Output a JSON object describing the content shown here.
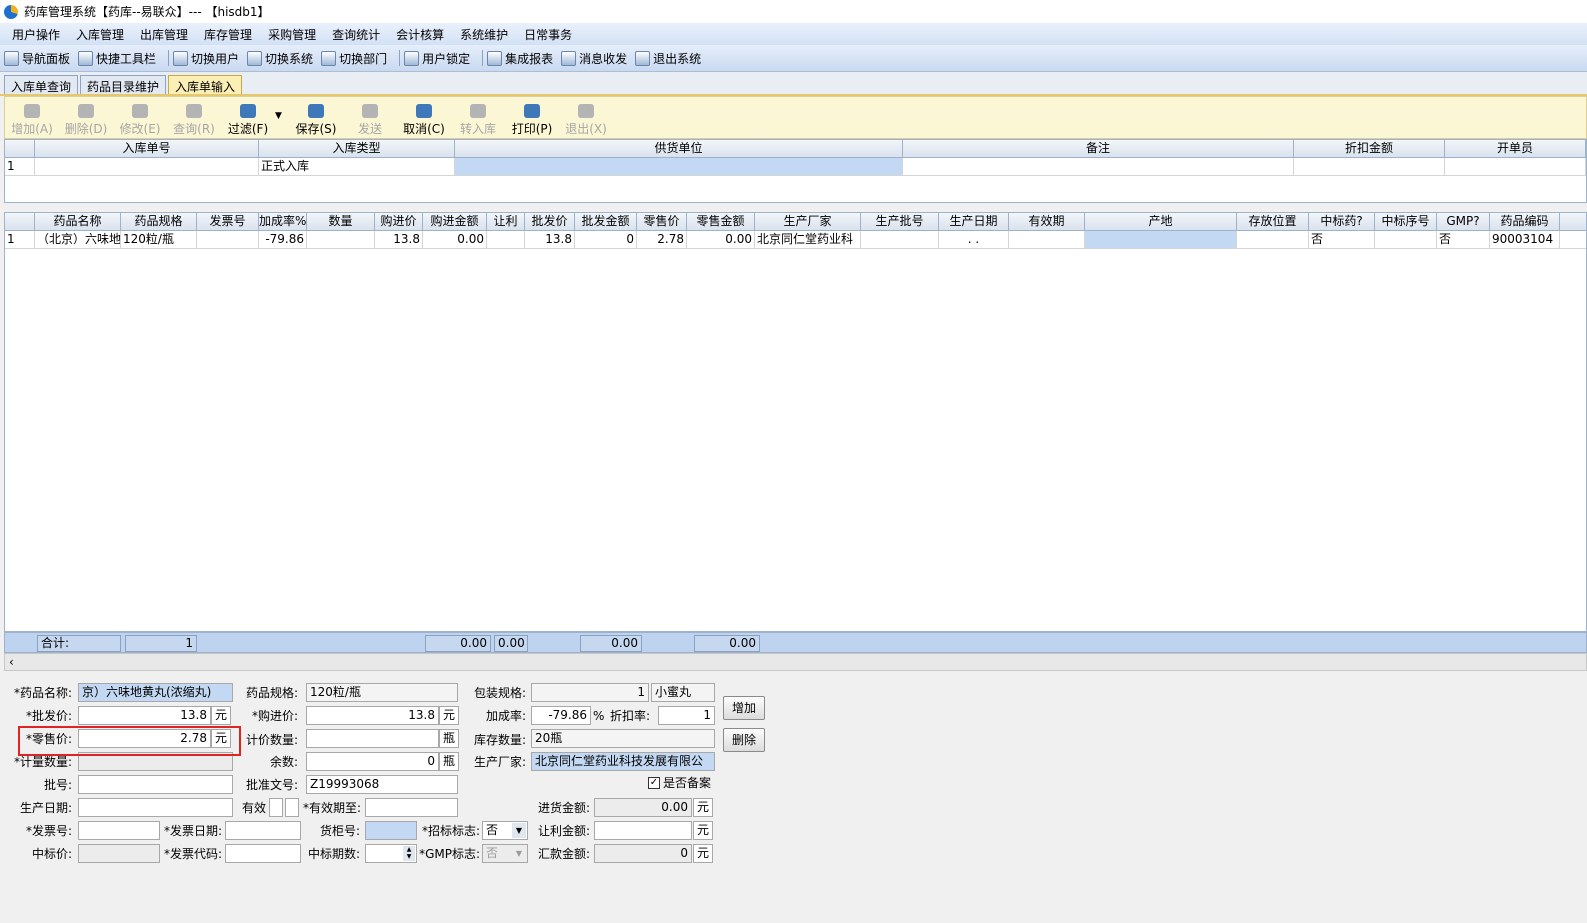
{
  "window": {
    "title": "药库管理系统【药库--易联众】--- 【hisdb1】"
  },
  "menu": [
    "用户操作",
    "入库管理",
    "出库管理",
    "库存管理",
    "采购管理",
    "查询统计",
    "会计核算",
    "系统维护",
    "日常事务"
  ],
  "quickbar": [
    "导航面板",
    "快捷工具栏",
    "切换用户",
    "切换系统",
    "切换部门",
    "用户锁定",
    "集成报表",
    "消息收发",
    "退出系统"
  ],
  "tabs": [
    "入库单查询",
    "药品目录维护",
    "入库单输入"
  ],
  "toolbar": [
    "增加(A)",
    "删除(D)",
    "修改(E)",
    "查询(R)",
    "过滤(F)",
    "保存(S)",
    "发送",
    "取消(C)",
    "转入库",
    "打印(P)",
    "退出(X)"
  ],
  "header_grid": {
    "columns": [
      "入库单号",
      "入库类型",
      "供货单位",
      "备注",
      "折扣金额",
      "开单员"
    ],
    "row": {
      "idx": "1",
      "no": "",
      "type": "正式入库",
      "supplier": "",
      "remark": "",
      "discount": "",
      "operator": ""
    }
  },
  "detail_grid": {
    "columns": [
      "药品名称",
      "药品规格",
      "发票号",
      "加成率%",
      "数量",
      "购进价",
      "购进金额",
      "让利",
      "批发价",
      "批发金额",
      "零售价",
      "零售金额",
      "生产厂家",
      "生产批号",
      "生产日期",
      "有效期",
      "产地",
      "存放位置",
      "中标药?",
      "中标序号",
      "GMP?",
      "药品编码"
    ],
    "row": {
      "idx": "1",
      "name": "（北京）六味地",
      "spec": "120粒/瓶",
      "invoice": "",
      "markup": "-79.86",
      "qty": "",
      "buy_price": "13.8",
      "buy_amount": "0.00",
      "rebate": "",
      "wholesale": "13.8",
      "wholesale_amount": "0",
      "retail": "2.78",
      "retail_amount": "0.00",
      "maker": "北京同仁堂药业科",
      "batch": "",
      "prod_date": ". .",
      "expire": "",
      "origin": "",
      "location": "",
      "bid": "否",
      "bid_no": "",
      "gmp": "否",
      "code": "90003104"
    },
    "sum_label": "合计:",
    "sum_count": "1",
    "sum_buy": "0.00",
    "sum_rebate": "0.00",
    "sum_wholesale": "0.00",
    "sum_retail": "0.00"
  },
  "form": {
    "drug_name_label": "*药品名称:",
    "drug_name": "京）六味地黄丸(浓缩丸)",
    "spec_label": "药品规格:",
    "spec": "120粒/瓶",
    "pack_label": "包装规格:",
    "pack_qty": "1",
    "pack_unit": "小蜜丸",
    "wholesale_label": "*批发价:",
    "wholesale": "13.8",
    "unit_yuan": "元",
    "buy_label": "*购进价:",
    "buy": "13.8",
    "markup_label": "加成率:",
    "markup": "-79.86",
    "percent": "%",
    "discount_label": "折扣率:",
    "discount": "1",
    "retail_label": "*零售价:",
    "retail": "2.78",
    "count_label": "计价数量:",
    "count_unit": "瓶",
    "stock_label": "库存数量:",
    "stock": "20瓶",
    "measure_label": "*计量数量:",
    "remainder_label": "余数:",
    "remainder": "0",
    "maker_label": "生产厂家:",
    "maker": "北京同仁堂药业科技发展有限公",
    "batch_label": "批号:",
    "approval_label": "批准文号:",
    "approval": "Z19993068",
    "filed_label": "是否备案",
    "prod_date_label": "生产日期:",
    "valid_label": "有效",
    "expire_label": "*有效期至:",
    "in_amount_label": "进货金额:",
    "in_amount": "0.00",
    "invoice_label": "*发票号:",
    "invoice_date_label": "*发票日期:",
    "shelf_label": "货柜号:",
    "bid_flag_label": "*招标标志:",
    "bid_flag": "否",
    "rebate_label": "让利金额:",
    "bid_price_label": "中标价:",
    "invoice_code_label": "*发票代码:",
    "bid_period_label": "中标期数:",
    "gmp_label": "*GMP标志:",
    "gmp": "否",
    "remit_label": "汇款金额:",
    "remit": "0",
    "add_button": "增加",
    "delete_button": "删除"
  }
}
